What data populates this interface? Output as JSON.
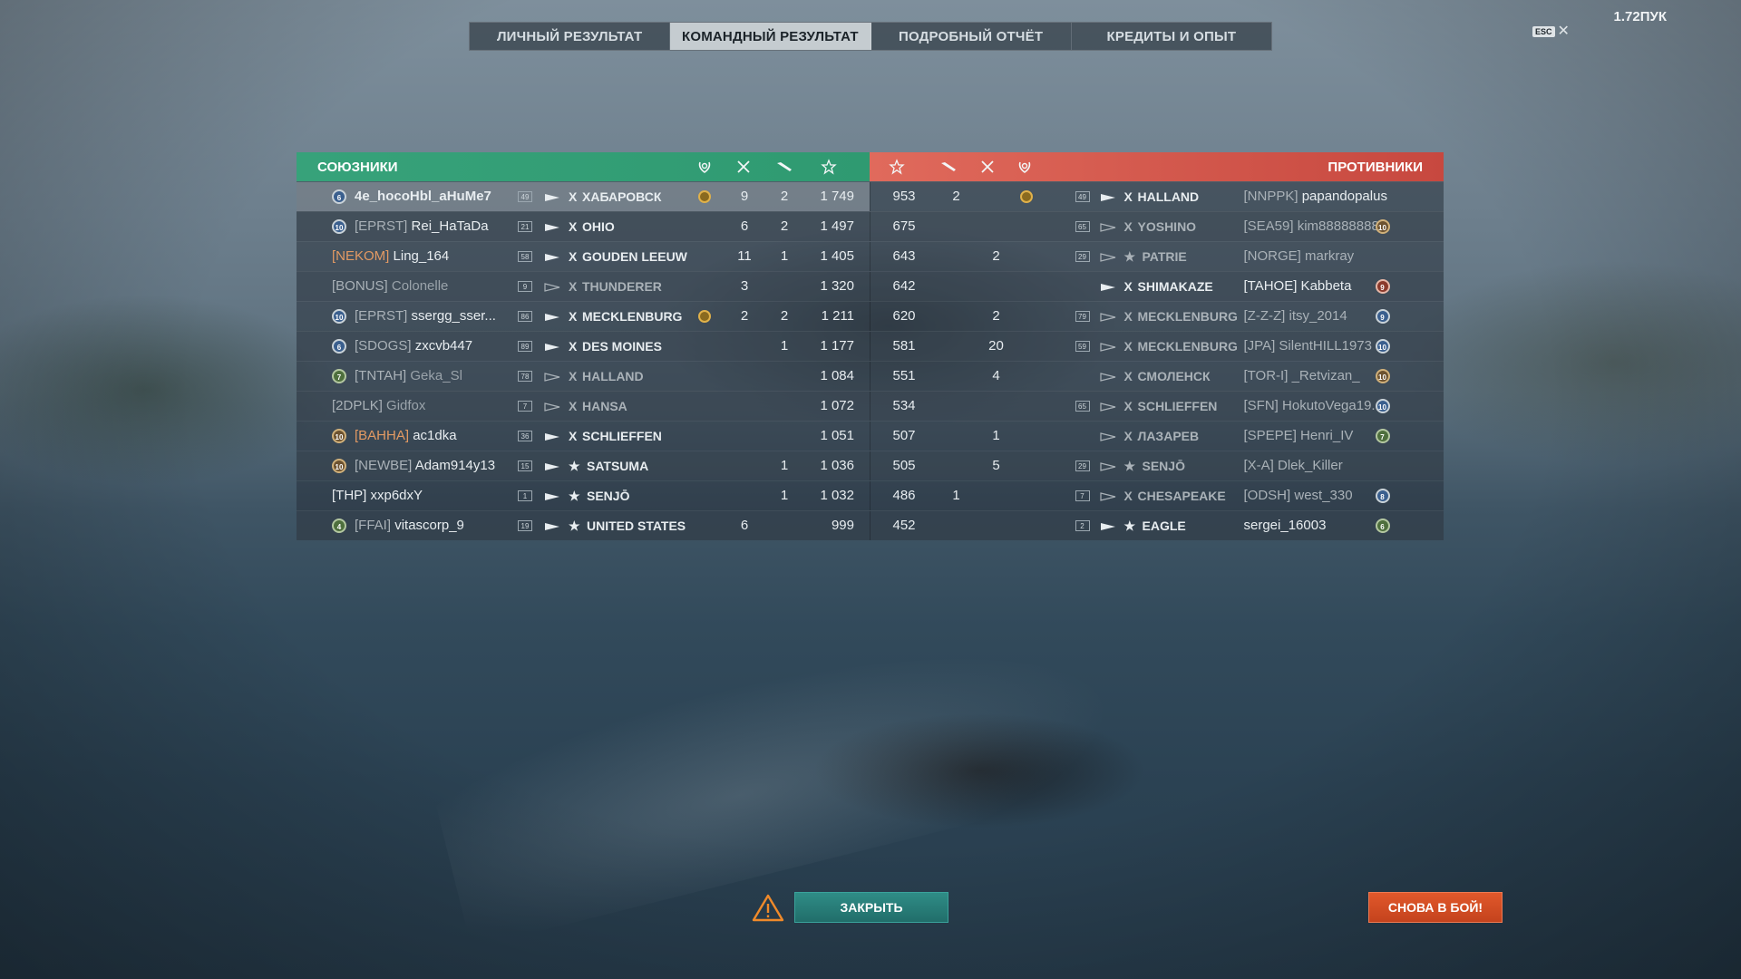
{
  "tabs": [
    {
      "label": "ЛИЧНЫЙ РЕЗУЛЬТАТ",
      "active": false
    },
    {
      "label": "КОМАНДНЫЙ РЕЗУЛЬТАТ",
      "active": true
    },
    {
      "label": "ПОДРОБНЫЙ ОТЧЁТ",
      "active": false
    },
    {
      "label": "КРЕДИТЫ И ОПЫТ",
      "active": false
    }
  ],
  "version": "1.72ПУК",
  "esc": {
    "key": "ESC",
    "close": "✕"
  },
  "allies_title": "СОЮЗНИКИ",
  "enemies_title": "ПРОТИВНИКИ",
  "header_icons": {
    "achievement": "laurel-icon",
    "kills": "crossed-swords-icon",
    "planes": "plane-icon",
    "score": "star-icon"
  },
  "allies": [
    {
      "rank": "6",
      "rank_color": "blue",
      "clan": "",
      "name": "4e_hocoHbl_aHuMe7",
      "level": "49",
      "tier": "X",
      "ship": "ХАБАРОВСК",
      "ach": true,
      "kills": "9",
      "planes": "2",
      "score": "1 749",
      "me": true,
      "dead": false
    },
    {
      "rank": "10",
      "rank_color": "blue",
      "clan": "[EPRST]",
      "name": "Rei_HaTaDa",
      "level": "21",
      "tier": "X",
      "ship": "OHIO",
      "ach": false,
      "kills": "6",
      "planes": "2",
      "score": "1 497",
      "dead": false
    },
    {
      "rank": "",
      "rank_color": "",
      "clan": "[NEKOM]",
      "clan_orange": true,
      "name": "Ling_164",
      "level": "58",
      "tier": "X",
      "ship": "GOUDEN LEEUW",
      "ach": false,
      "kills": "11",
      "planes": "1",
      "score": "1 405",
      "dead": false
    },
    {
      "rank": "",
      "rank_color": "",
      "clan": "[BONUS]",
      "name": "Colonelle",
      "level": "9",
      "tier": "X",
      "ship": "THUNDERER",
      "ach": false,
      "kills": "3",
      "planes": "",
      "score": "1 320",
      "dead": true
    },
    {
      "rank": "10",
      "rank_color": "blue",
      "clan": "[EPRST]",
      "name": "ssergg_sser...",
      "level": "86",
      "tier": "X",
      "ship": "MECKLENBURG",
      "ach": true,
      "kills": "2",
      "planes": "2",
      "score": "1 211",
      "dead": false
    },
    {
      "rank": "6",
      "rank_color": "blue",
      "clan": "[SDOGS]",
      "name": "zxcvb447",
      "level": "89",
      "tier": "X",
      "ship": "DES MOINES",
      "ach": false,
      "kills": "",
      "planes": "1",
      "score": "1 177",
      "dead": false
    },
    {
      "rank": "7",
      "rank_color": "green",
      "clan": "[TNTAH]",
      "name": "Geka_Sl",
      "level": "78",
      "tier": "X",
      "ship": "HALLAND",
      "ach": false,
      "kills": "",
      "planes": "",
      "score": "1 084",
      "dead": true
    },
    {
      "rank": "",
      "rank_color": "",
      "clan": "[2DPLK]",
      "name": "Gidfox",
      "level": "7",
      "tier": "X",
      "ship": "HANSA",
      "ach": false,
      "kills": "",
      "planes": "",
      "score": "1 072",
      "dead": true
    },
    {
      "rank": "10",
      "rank_color": "bronze",
      "clan": "[BAHHA]",
      "clan_orange": true,
      "name": "ac1dka",
      "level": "36",
      "tier": "X",
      "ship": "SCHLIEFFEN",
      "ach": false,
      "kills": "",
      "planes": "",
      "score": "1 051",
      "dead": false
    },
    {
      "rank": "10",
      "rank_color": "bronze",
      "clan": "[NEWBE]",
      "name": "Adam914y13",
      "level": "15",
      "tier": "★",
      "ship": "SATSUMA",
      "ach": false,
      "kills": "",
      "planes": "1",
      "score": "1 036",
      "dead": false
    },
    {
      "rank": "",
      "rank_color": "",
      "clan": "",
      "name": "[THP] xxp6dxY",
      "level": "1",
      "tier": "★",
      "ship": "SENJŌ",
      "ach": false,
      "kills": "",
      "planes": "1",
      "score": "1 032",
      "dead": false
    },
    {
      "rank": "4",
      "rank_color": "green",
      "clan": "[FFAI]",
      "name": "vitascorp_9",
      "level": "19",
      "tier": "★",
      "ship": "UNITED STATES",
      "ach": false,
      "kills": "6",
      "planes": "",
      "score": "999",
      "dead": false
    }
  ],
  "enemies": [
    {
      "score": "953",
      "planes": "2",
      "kills": "",
      "ach": true,
      "level": "49",
      "tier": "X",
      "ship": "HALLAND",
      "clan": "[NNPPK]",
      "name": "papandopalus",
      "rank": "",
      "rank_color": "",
      "dead": false
    },
    {
      "score": "675",
      "planes": "",
      "kills": "",
      "ach": false,
      "level": "65",
      "tier": "X",
      "ship": "YOSHINO",
      "clan": "[SEA59]",
      "name": "kim88888888",
      "rank": "10",
      "rank_color": "bronze",
      "dead": true
    },
    {
      "score": "643",
      "planes": "",
      "kills": "2",
      "ach": false,
      "level": "29",
      "tier": "★",
      "ship": "PATRIE",
      "clan": "[NORGE]",
      "name": "markray",
      "rank": "",
      "rank_color": "",
      "dead": true
    },
    {
      "score": "642",
      "planes": "",
      "kills": "",
      "ach": false,
      "level": "",
      "tier": "X",
      "ship": "SHIMAKAZE",
      "clan": "",
      "name": "[TAHOE] Kabbeta",
      "rank": "9",
      "rank_color": "red",
      "dead": false
    },
    {
      "score": "620",
      "planes": "",
      "kills": "2",
      "ach": false,
      "level": "79",
      "tier": "X",
      "ship": "MECKLENBURG",
      "clan": "[Z-Z-Z]",
      "name": "itsy_2014",
      "rank": "9",
      "rank_color": "blue",
      "dead": true
    },
    {
      "score": "581",
      "planes": "",
      "kills": "20",
      "ach": false,
      "level": "59",
      "tier": "X",
      "ship": "MECKLENBURG",
      "clan": "[JPA]",
      "name": "SilentHILL1973",
      "rank": "10",
      "rank_color": "blue",
      "dead": true
    },
    {
      "score": "551",
      "planes": "",
      "kills": "4",
      "ach": false,
      "level": "",
      "tier": "X",
      "ship": "СМОЛЕНСК",
      "clan": "[TOR-I]",
      "name": "_Retvizan_",
      "rank": "10",
      "rank_color": "bronze",
      "dead": true
    },
    {
      "score": "534",
      "planes": "",
      "kills": "",
      "ach": false,
      "level": "65",
      "tier": "X",
      "ship": "SCHLIEFFEN",
      "clan": "[SFN]",
      "name": "HokutoVega19...",
      "rank": "10",
      "rank_color": "blue",
      "dead": true
    },
    {
      "score": "507",
      "planes": "",
      "kills": "1",
      "ach": false,
      "level": "",
      "tier": "X",
      "ship": "ЛАЗАРЕВ",
      "clan": "[SPEPE]",
      "name": "Henri_IV",
      "rank": "7",
      "rank_color": "green",
      "dead": true
    },
    {
      "score": "505",
      "planes": "",
      "kills": "5",
      "ach": false,
      "level": "29",
      "tier": "★",
      "ship": "SENJŌ",
      "clan": "[X-A]",
      "name": "Dlek_Killer",
      "rank": "",
      "rank_color": "",
      "dead": true
    },
    {
      "score": "486",
      "planes": "1",
      "kills": "",
      "ach": false,
      "level": "7",
      "tier": "X",
      "ship": "CHESAPEAKE",
      "clan": "[ODSH]",
      "name": "west_330",
      "rank": "8",
      "rank_color": "blue",
      "dead": true
    },
    {
      "score": "452",
      "planes": "",
      "kills": "",
      "ach": false,
      "level": "2",
      "tier": "★",
      "ship": "EAGLE",
      "clan": "",
      "name": "sergei_16003",
      "rank": "6",
      "rank_color": "green",
      "dead": false
    }
  ],
  "buttons": {
    "close": "ЗАКРЫТЬ",
    "again": "СНОВА В БОЙ!"
  },
  "colors": {
    "allies": "#33a077",
    "enemies": "#d65649",
    "close_btn": "#267a75",
    "again_btn": "#d54f24"
  }
}
